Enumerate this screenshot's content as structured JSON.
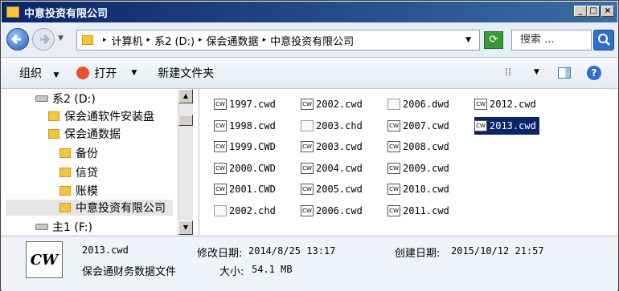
{
  "window": {
    "title": "中意投资有限公司",
    "min_label": "_",
    "max_label": "□",
    "close_label": "×"
  },
  "address": {
    "crumbs": [
      "计算机",
      "系2 (D:)",
      "保会通数据",
      "中意投资有限公司"
    ],
    "search_placeholder": "搜索 ...",
    "refresh_icon": "refresh-icon"
  },
  "toolbar": {
    "organize_label": "组织",
    "open_label": "打开",
    "new_folder_label": "新建文件夹"
  },
  "tree": {
    "items": [
      {
        "label": "系2 (D:)",
        "kind": "drive"
      },
      {
        "label": "保会通软件安装盘",
        "kind": "folder"
      },
      {
        "label": "保会通数据",
        "kind": "folder"
      },
      {
        "label": "备份",
        "kind": "folder"
      },
      {
        "label": "信贷",
        "kind": "folder"
      },
      {
        "label": "账模",
        "kind": "folder"
      },
      {
        "label": "中意投资有限公司",
        "kind": "folder",
        "selected": true
      },
      {
        "label": "主1 (F:)",
        "kind": "drive"
      }
    ]
  },
  "files": [
    {
      "name": "1997.cwd",
      "type": "cw"
    },
    {
      "name": "1998.cwd",
      "type": "cw"
    },
    {
      "name": "1999.CWD",
      "type": "cw"
    },
    {
      "name": "2000.CWD",
      "type": "cw"
    },
    {
      "name": "2001.CWD",
      "type": "cw"
    },
    {
      "name": "2002.chd",
      "type": "doc"
    },
    {
      "name": "2002.cwd",
      "type": "cw"
    },
    {
      "name": "2003.chd",
      "type": "doc"
    },
    {
      "name": "2003.cwd",
      "type": "cw"
    },
    {
      "name": "2004.cwd",
      "type": "cw"
    },
    {
      "name": "2005.cwd",
      "type": "cw"
    },
    {
      "name": "2006.cwd",
      "type": "cw"
    },
    {
      "name": "2006.dwd",
      "type": "doc"
    },
    {
      "name": "2007.cwd",
      "type": "cw"
    },
    {
      "name": "2008.cwd",
      "type": "cw"
    },
    {
      "name": "2009.cwd",
      "type": "cw"
    },
    {
      "name": "2010.cwd",
      "type": "cw"
    },
    {
      "name": "2011.cwd",
      "type": "cw"
    },
    {
      "name": "2012.cwd",
      "type": "cw"
    },
    {
      "name": "2013.cwd",
      "type": "cw",
      "selected": true
    }
  ],
  "details": {
    "icon_text": "CW",
    "file_name": "2013.cwd",
    "file_type": "保会通财务数据文件",
    "modified_label": "修改日期:",
    "modified_value": "2014/8/25 13:17",
    "created_label": "创建日期:",
    "created_value": "2015/10/12 21:57",
    "size_label": "大小:",
    "size_value": "54.1 MB"
  },
  "colors": {
    "selection": "#0a246a",
    "title_start": "#0a246a",
    "title_end": "#3a6ea5"
  }
}
